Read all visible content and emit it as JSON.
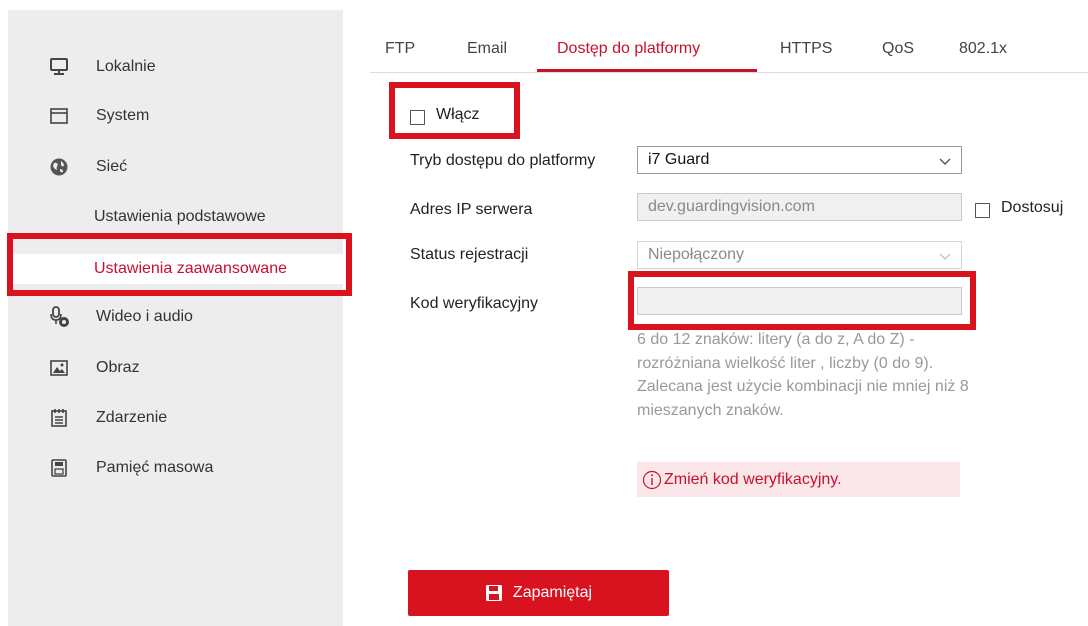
{
  "sidebar": {
    "items": [
      {
        "label": "Lokalnie",
        "icon": "monitor-icon"
      },
      {
        "label": "System",
        "icon": "window-icon"
      },
      {
        "label": "Sieć",
        "icon": "globe-icon"
      },
      {
        "label": "Wideo i audio",
        "icon": "microphone-camera-icon"
      },
      {
        "label": "Obraz",
        "icon": "image-icon"
      },
      {
        "label": "Zdarzenie",
        "icon": "calendar-list-icon"
      },
      {
        "label": "Pamięć masowa",
        "icon": "storage-icon"
      }
    ],
    "subitems": [
      {
        "label": "Ustawienia podstawowe"
      },
      {
        "label": "Ustawienia zaawansowane",
        "active": true
      }
    ]
  },
  "tabs": [
    {
      "label": "FTP"
    },
    {
      "label": "Email"
    },
    {
      "label": "Dostęp do platformy",
      "active": true
    },
    {
      "label": "HTTPS"
    },
    {
      "label": "QoS"
    },
    {
      "label": "802.1x"
    }
  ],
  "form": {
    "enable_label": "Włącz",
    "enable_checked": false,
    "access_mode": {
      "label": "Tryb dostępu do platformy",
      "value": "i7 Guard"
    },
    "server_ip": {
      "label": "Adres IP serwera",
      "value": "dev.guardingvision.com",
      "custom_label": "Dostosuj",
      "custom_checked": false
    },
    "registration_status": {
      "label": "Status rejestracji",
      "value": "Niepołączony"
    },
    "verification_code": {
      "label": "Kod weryfikacyjny",
      "value": ""
    },
    "hint": "6 do 12 znaków: litery (a do z, A do Z) - rozróżniana wielkość liter , liczby (0 do 9). Zalecana jest użycie kombinacji nie mniej niż 8 mieszanych znaków.",
    "error": "Zmień kod weryfikacyjny."
  },
  "save_button": {
    "label": "Zapamiętaj",
    "icon": "floppy-disk-icon"
  },
  "colors": {
    "accent": "#c8102e",
    "highlight_outline": "#d9121e",
    "sidebar_bg": "#ededed",
    "error_bg": "#fbe7ea"
  }
}
